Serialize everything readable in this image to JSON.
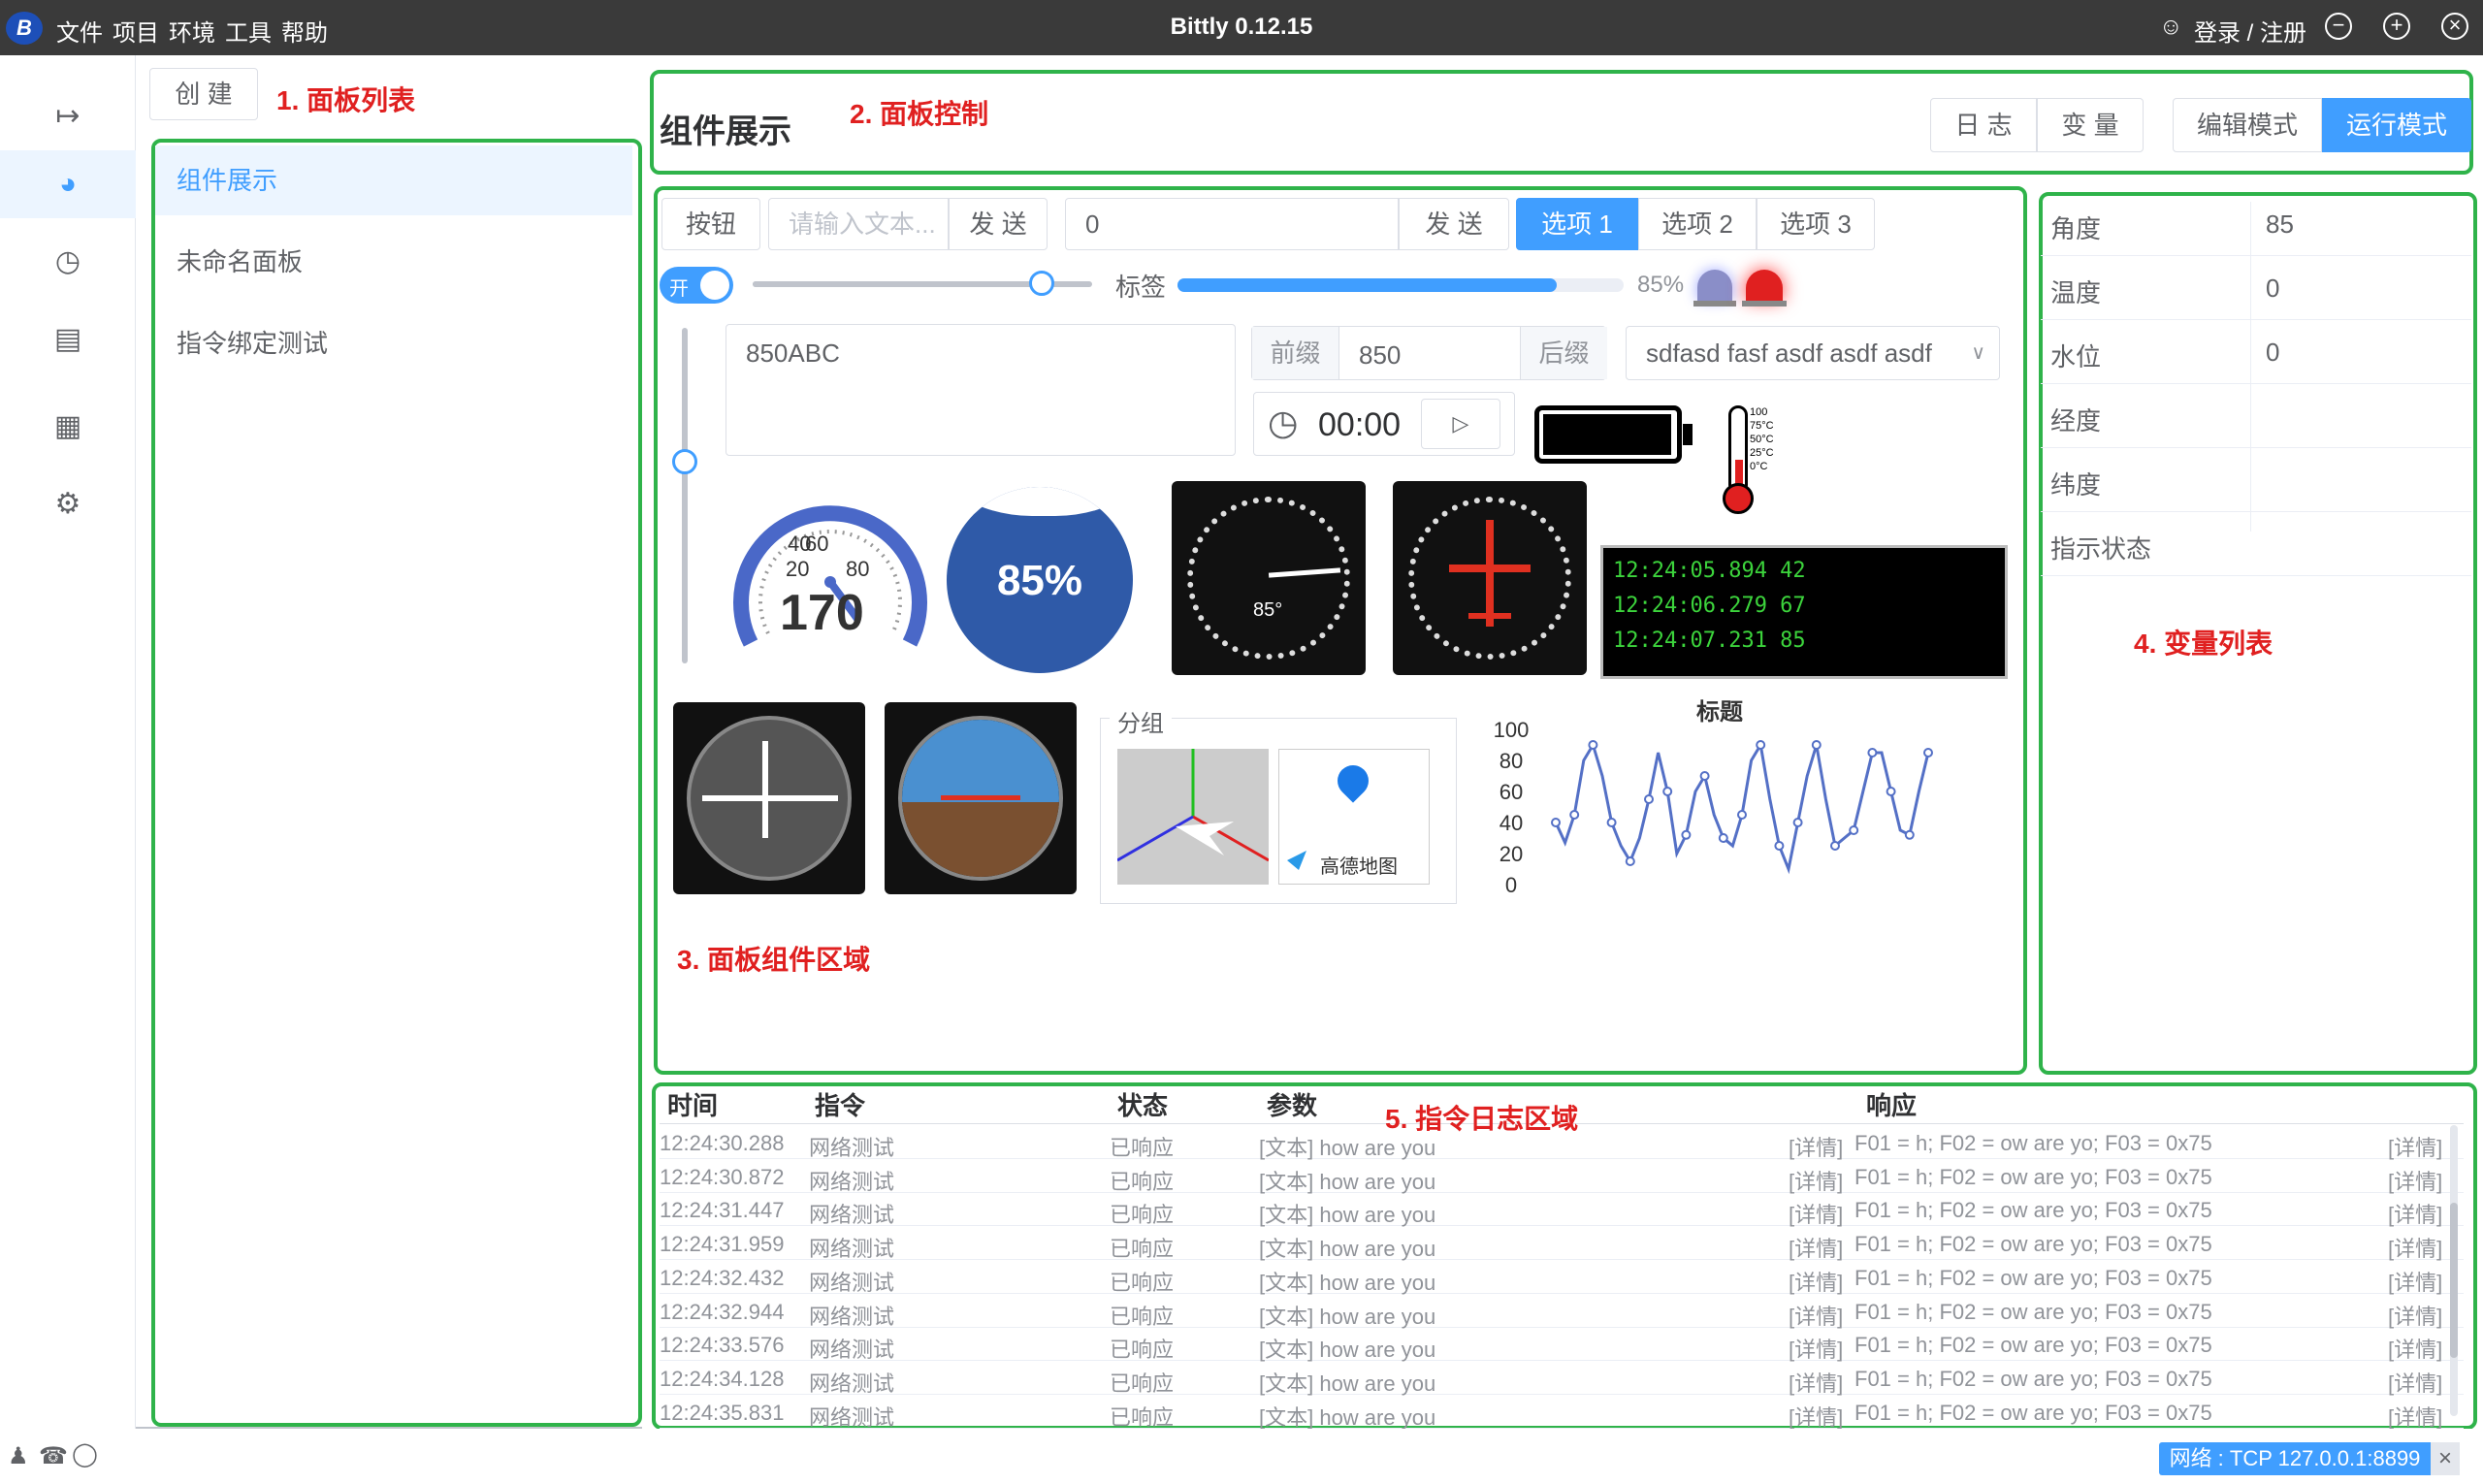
{
  "app": {
    "title": "Bittly 0.12.15",
    "logo_text": "B"
  },
  "menu": [
    "文件",
    "项目",
    "环境",
    "工具",
    "帮助"
  ],
  "account": {
    "login_label": "登录 / 注册"
  },
  "window_controls": {
    "minimize": "−",
    "maximize": "+",
    "close": "×"
  },
  "sidebar_icons": [
    "ruler-icon",
    "dashboard-icon",
    "history-icon",
    "book-icon",
    "sitemap-icon",
    "settings-icon"
  ],
  "panels": {
    "create_label": "创 建",
    "items": [
      "组件展示",
      "未命名面板",
      "指令绑定测试"
    ],
    "active_index": 0
  },
  "annotations": {
    "panel_list": "1. 面板列表",
    "panel_control": "2. 面板控制",
    "component_area": "3. 面板组件区域",
    "variable_list": "4. 变量列表",
    "command_log": "5. 指令日志区域"
  },
  "header": {
    "title": "组件展示",
    "log_tab": "日 志",
    "var_tab": "变 量",
    "edit_mode": "编辑模式",
    "run_mode": "运行模式",
    "active_mode": "run"
  },
  "widgets": {
    "button_label": "按钮",
    "text_input_placeholder": "请输入文本...",
    "send_label": "发 送",
    "number_input_value": "0",
    "send2_label": "发 送",
    "options": [
      "选项 1",
      "选项 2",
      "选项 3"
    ],
    "selected_option": 0,
    "switch_label": "开",
    "switch_on": true,
    "slider_value": 0.85,
    "tag_label": "标签",
    "progress_value": 0.85,
    "progress_text": "85%",
    "textarea_value": "850ABC",
    "prefix_label": "前缀",
    "prefix_value": "850",
    "suffix_label": "后缀",
    "select_value": "sdfasd fasf asdf asdf asdf",
    "timer_text": "00:00",
    "battery_level": 1.0,
    "gauge": {
      "value_text": "170",
      "ticks": [
        "20",
        "40",
        "60",
        "80"
      ]
    },
    "water_text": "85%",
    "water_level": 0.85,
    "altimeter_text": "85°",
    "terminal_lines": [
      "12:24:05.894 42",
      "12:24:06.279 67",
      "12:24:07.231 85"
    ],
    "group_title": "分组",
    "map_label": "高德地图",
    "thermo_labels": [
      "100",
      "75°C",
      "50°C",
      "25°C",
      "0°C"
    ],
    "vslider_value": 0.6
  },
  "chart_data": {
    "type": "line",
    "title": "标题",
    "yticks": [
      "100",
      "80",
      "60",
      "40",
      "20",
      "0"
    ],
    "ylim": [
      0,
      100
    ],
    "values": [
      40,
      27,
      45,
      80,
      90,
      70,
      40,
      25,
      15,
      30,
      55,
      85,
      60,
      20,
      32,
      60,
      70,
      45,
      30,
      25,
      45,
      80,
      90,
      55,
      25,
      10,
      40,
      70,
      90,
      55,
      25,
      30,
      35,
      60,
      85,
      85,
      60,
      35,
      32,
      60,
      85
    ]
  },
  "variables": [
    {
      "name": "角度",
      "value": "85"
    },
    {
      "name": "温度",
      "value": "0"
    },
    {
      "name": "水位",
      "value": "0"
    },
    {
      "name": "经度",
      "value": ""
    },
    {
      "name": "纬度",
      "value": ""
    },
    {
      "name": "指示状态",
      "value": ""
    }
  ],
  "log": {
    "columns": [
      "时间",
      "指令",
      "状态",
      "参数",
      "响应"
    ],
    "rows": [
      {
        "time": "12:24:30.288",
        "cmd": "网络测试",
        "status": "已响应",
        "param": "[文本] how are you",
        "detail1": "[详情]",
        "resp": "F01 = h; F02 = ow are yo; F03 = 0x75",
        "detail2": "[详情]"
      },
      {
        "time": "12:24:30.872",
        "cmd": "网络测试",
        "status": "已响应",
        "param": "[文本] how are you",
        "detail1": "[详情]",
        "resp": "F01 = h; F02 = ow are yo; F03 = 0x75",
        "detail2": "[详情]"
      },
      {
        "time": "12:24:31.447",
        "cmd": "网络测试",
        "status": "已响应",
        "param": "[文本] how are you",
        "detail1": "[详情]",
        "resp": "F01 = h; F02 = ow are yo; F03 = 0x75",
        "detail2": "[详情]"
      },
      {
        "time": "12:24:31.959",
        "cmd": "网络测试",
        "status": "已响应",
        "param": "[文本] how are you",
        "detail1": "[详情]",
        "resp": "F01 = h; F02 = ow are yo; F03 = 0x75",
        "detail2": "[详情]"
      },
      {
        "time": "12:24:32.432",
        "cmd": "网络测试",
        "status": "已响应",
        "param": "[文本] how are you",
        "detail1": "[详情]",
        "resp": "F01 = h; F02 = ow are yo; F03 = 0x75",
        "detail2": "[详情]"
      },
      {
        "time": "12:24:32.944",
        "cmd": "网络测试",
        "status": "已响应",
        "param": "[文本] how are you",
        "detail1": "[详情]",
        "resp": "F01 = h; F02 = ow are yo; F03 = 0x75",
        "detail2": "[详情]"
      },
      {
        "time": "12:24:33.576",
        "cmd": "网络测试",
        "status": "已响应",
        "param": "[文本] how are you",
        "detail1": "[详情]",
        "resp": "F01 = h; F02 = ow are yo; F03 = 0x75",
        "detail2": "[详情]"
      },
      {
        "time": "12:24:34.128",
        "cmd": "网络测试",
        "status": "已响应",
        "param": "[文本] how are you",
        "detail1": "[详情]",
        "resp": "F01 = h; F02 = ow are yo; F03 = 0x75",
        "detail2": "[详情]"
      },
      {
        "time": "12:24:35.831",
        "cmd": "网络测试",
        "status": "已响应",
        "param": "[文本] how are you",
        "detail1": "[详情]",
        "resp": "F01 = h; F02 = ow are yo; F03 = 0x75",
        "detail2": "[详情]"
      }
    ]
  },
  "status": {
    "network": "网络 : TCP 127.0.0.1:8899",
    "close": "×"
  },
  "colors": {
    "accent": "#409eff",
    "annotation": "#e02020",
    "highlight": "#2fb34a",
    "titlebar": "#3a3a3a"
  }
}
